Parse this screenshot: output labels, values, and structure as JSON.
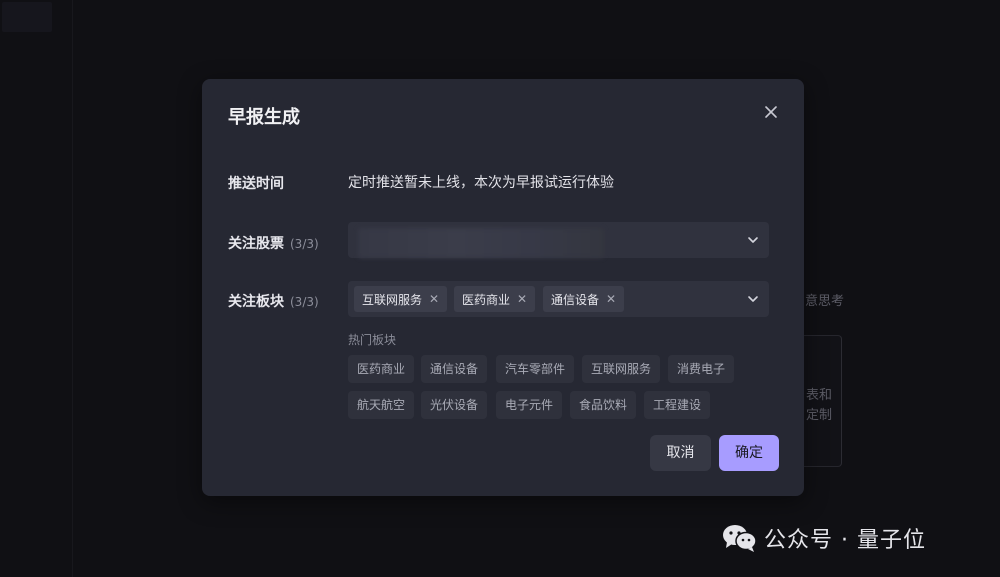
{
  "background": {
    "partial_text_1": "意思考",
    "partial_text_2a": "表和",
    "partial_text_2b": "定制"
  },
  "watermark": {
    "text": "公众号 · 量子位",
    "icon": "wechat-icon"
  },
  "modal": {
    "title": "早报生成",
    "close_icon": "close-icon",
    "push_time": {
      "label": "推送时间",
      "text": "定时推送暂未上线，本次为早报试运行体验"
    },
    "stocks": {
      "label": "关注股票",
      "count": "(3/3)"
    },
    "sectors": {
      "label": "关注板块",
      "count": "(3/3)",
      "selected": [
        "互联网服务",
        "医药商业",
        "通信设备"
      ],
      "remove_symbol": "✕"
    },
    "hot": {
      "title": "热门板块",
      "row1": [
        "医药商业",
        "通信设备",
        "汽车零部件",
        "互联网服务",
        "消费电子"
      ],
      "row2": [
        "航天航空",
        "光伏设备",
        "电子元件",
        "食品饮料",
        "工程建设"
      ]
    },
    "buttons": {
      "cancel": "取消",
      "confirm": "确定"
    }
  },
  "colors": {
    "modal_bg": "#262833",
    "accent": "#a79cff",
    "input_bg": "#30323e"
  }
}
